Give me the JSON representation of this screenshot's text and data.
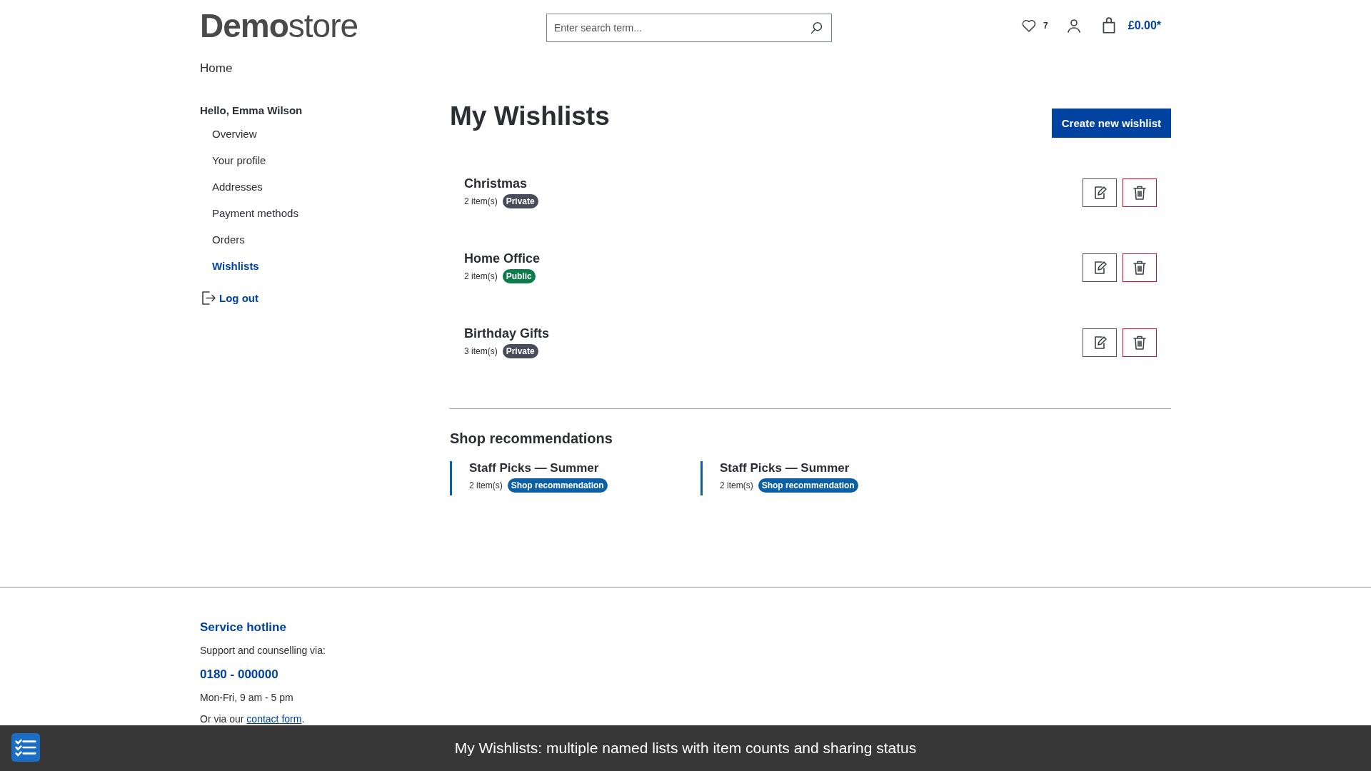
{
  "header": {
    "logo_bold": "Demo",
    "logo_light": "store",
    "search": {
      "placeholder": "Enter search term..."
    },
    "wishlist_count": "7",
    "cart_total": "£0.00*"
  },
  "breadcrumb": "Home",
  "sidebar": {
    "greeting": "Hello, Emma Wilson",
    "items": [
      {
        "label": "Overview",
        "selected": false
      },
      {
        "label": "Your profile",
        "selected": false
      },
      {
        "label": "Addresses",
        "selected": false
      },
      {
        "label": "Payment methods",
        "selected": false
      },
      {
        "label": "Orders",
        "selected": false
      },
      {
        "label": "Wishlists",
        "selected": true
      }
    ],
    "logout": "Log out"
  },
  "page_title": "My Wishlists",
  "create_button": "Create new wishlist",
  "wishlists": [
    {
      "name": "Christmas",
      "count": "2 item(s)",
      "badge": {
        "label": "Private",
        "kind": "private"
      }
    },
    {
      "name": "Home Office",
      "count": "2 item(s)",
      "badge": {
        "label": "Public",
        "kind": "public"
      }
    },
    {
      "name": "Birthday Gifts",
      "count": "3 item(s)",
      "badge": {
        "label": "Private",
        "kind": "private"
      }
    }
  ],
  "recommendations": {
    "title": "Shop recommendations",
    "items": [
      {
        "name": "Staff Picks — Summer",
        "count": "2 item(s)",
        "badge": "Shop recommendation"
      },
      {
        "name": "Staff Picks — Summer",
        "count": "2 item(s)",
        "badge": "Shop recommendation"
      }
    ]
  },
  "footer": {
    "title": "Service hotline",
    "text": "Support and counselling via:",
    "phone": "0180 - 000000",
    "hours": "Mon-Fri, 9 am - 5 pm",
    "contact_prefix": "Or via our",
    "contact_link": "contact form",
    "contact_suffix": "."
  },
  "caption": "My Wishlists: multiple named lists with item counts and sharing status"
}
